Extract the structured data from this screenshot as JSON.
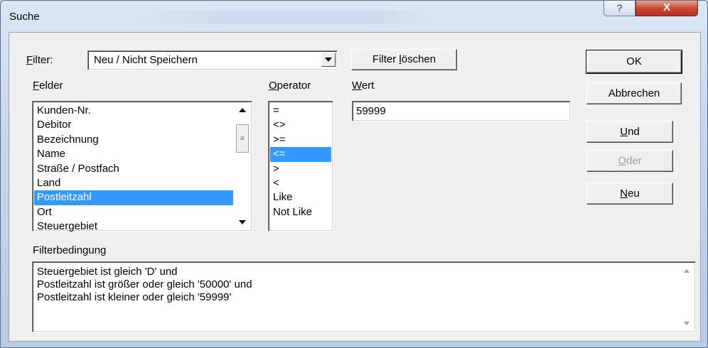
{
  "window": {
    "title": "Suche",
    "help_label": "?",
    "close_label": "X"
  },
  "filter": {
    "label_hotkey": "F",
    "label_rest": "ilter:",
    "selected": "Neu / Nicht Speichern",
    "clear_label_a": "Filter ",
    "clear_label_hotkey": "l",
    "clear_label_b": "öschen"
  },
  "fields": {
    "label_hotkey": "F",
    "label_rest": "elder",
    "items": [
      {
        "text": "Kunden-Nr.",
        "selected": false
      },
      {
        "text": "Debitor",
        "selected": false
      },
      {
        "text": "Bezeichnung",
        "selected": false
      },
      {
        "text": "Name",
        "selected": false
      },
      {
        "text": "Straße / Postfach",
        "selected": false
      },
      {
        "text": "Land",
        "selected": false
      },
      {
        "text": "Postleitzahl",
        "selected": true
      },
      {
        "text": "Ort",
        "selected": false
      },
      {
        "text": "Steuergebiet",
        "selected": false
      }
    ]
  },
  "operator": {
    "label_hotkey": "O",
    "label_rest": "perator",
    "items": [
      {
        "text": "=",
        "selected": false
      },
      {
        "text": "<>",
        "selected": false
      },
      {
        "text": ">=",
        "selected": false
      },
      {
        "text": "<=",
        "selected": true
      },
      {
        "text": ">",
        "selected": false
      },
      {
        "text": "<",
        "selected": false
      },
      {
        "text": "Like",
        "selected": false
      },
      {
        "text": "Not Like",
        "selected": false
      }
    ]
  },
  "value": {
    "label_hotkey": "W",
    "label_rest": "ert",
    "text": "59999"
  },
  "buttons": {
    "ok": "OK",
    "cancel": "Abbrechen",
    "and_hotkey": "U",
    "and_rest": "nd",
    "or_hotkey": "O",
    "or_rest": "der",
    "new_hotkey": "N",
    "new_rest": "eu"
  },
  "condition": {
    "label": "Filterbedingung",
    "lines": [
      "Steuergebiet ist gleich 'D' und",
      "Postleitzahl ist größer oder gleich '50000' und",
      "Postleitzahl ist kleiner oder gleich '59999'"
    ]
  }
}
